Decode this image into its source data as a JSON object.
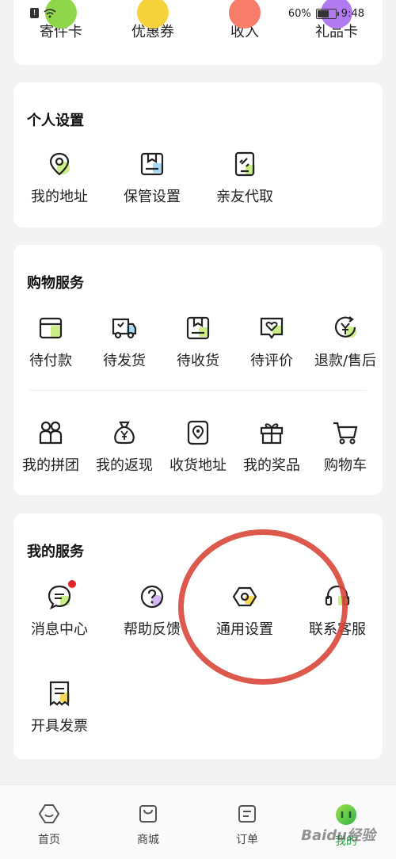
{
  "status_bar": {
    "battery": "60%",
    "time": "9:48"
  },
  "top_card": {
    "items": [
      {
        "label": "寄件卡"
      },
      {
        "label": "优惠券"
      },
      {
        "label": "收入"
      },
      {
        "label": "礼品卡"
      }
    ]
  },
  "personal_settings": {
    "title": "个人设置",
    "items": [
      {
        "label": "我的地址",
        "icon": "location-icon"
      },
      {
        "label": "保管设置",
        "icon": "package-icon"
      },
      {
        "label": "亲友代取",
        "icon": "tablet-link-icon"
      }
    ]
  },
  "shopping_services": {
    "title": "购物服务",
    "row1": [
      {
        "label": "待付款",
        "icon": "wallet-icon"
      },
      {
        "label": "待发货",
        "icon": "truck-icon"
      },
      {
        "label": "待收货",
        "icon": "box-icon"
      },
      {
        "label": "待评价",
        "icon": "heart-message-icon"
      },
      {
        "label": "退款/售后",
        "icon": "refund-icon"
      }
    ],
    "row2": [
      {
        "label": "我的拼团",
        "icon": "group-icon"
      },
      {
        "label": "我的返现",
        "icon": "money-bag-icon"
      },
      {
        "label": "收货地址",
        "icon": "map-pin-icon"
      },
      {
        "label": "我的奖品",
        "icon": "gift-icon"
      },
      {
        "label": "购物车",
        "icon": "cart-icon"
      }
    ]
  },
  "my_services": {
    "title": "我的服务",
    "row1": [
      {
        "label": "消息中心",
        "icon": "message-icon"
      },
      {
        "label": "帮助反馈",
        "icon": "help-icon"
      },
      {
        "label": "通用设置",
        "icon": "settings-hex-icon"
      },
      {
        "label": "联系客服",
        "icon": "headset-icon"
      }
    ],
    "row2": [
      {
        "label": "开具发票",
        "icon": "invoice-icon"
      }
    ]
  },
  "bottom_nav": {
    "items": [
      {
        "label": "首页",
        "icon": "home-icon"
      },
      {
        "label": "商城",
        "icon": "shopping-bag-icon"
      },
      {
        "label": "订单",
        "icon": "order-icon"
      },
      {
        "label": "我的",
        "icon": "profile-icon"
      }
    ]
  },
  "watermark": "Baidu经验",
  "colors": {
    "accent_green": "#31b44b",
    "accent_yellow": "#f5d23a",
    "annotation_red": "#d9473a",
    "badge_red": "#e2262a"
  }
}
